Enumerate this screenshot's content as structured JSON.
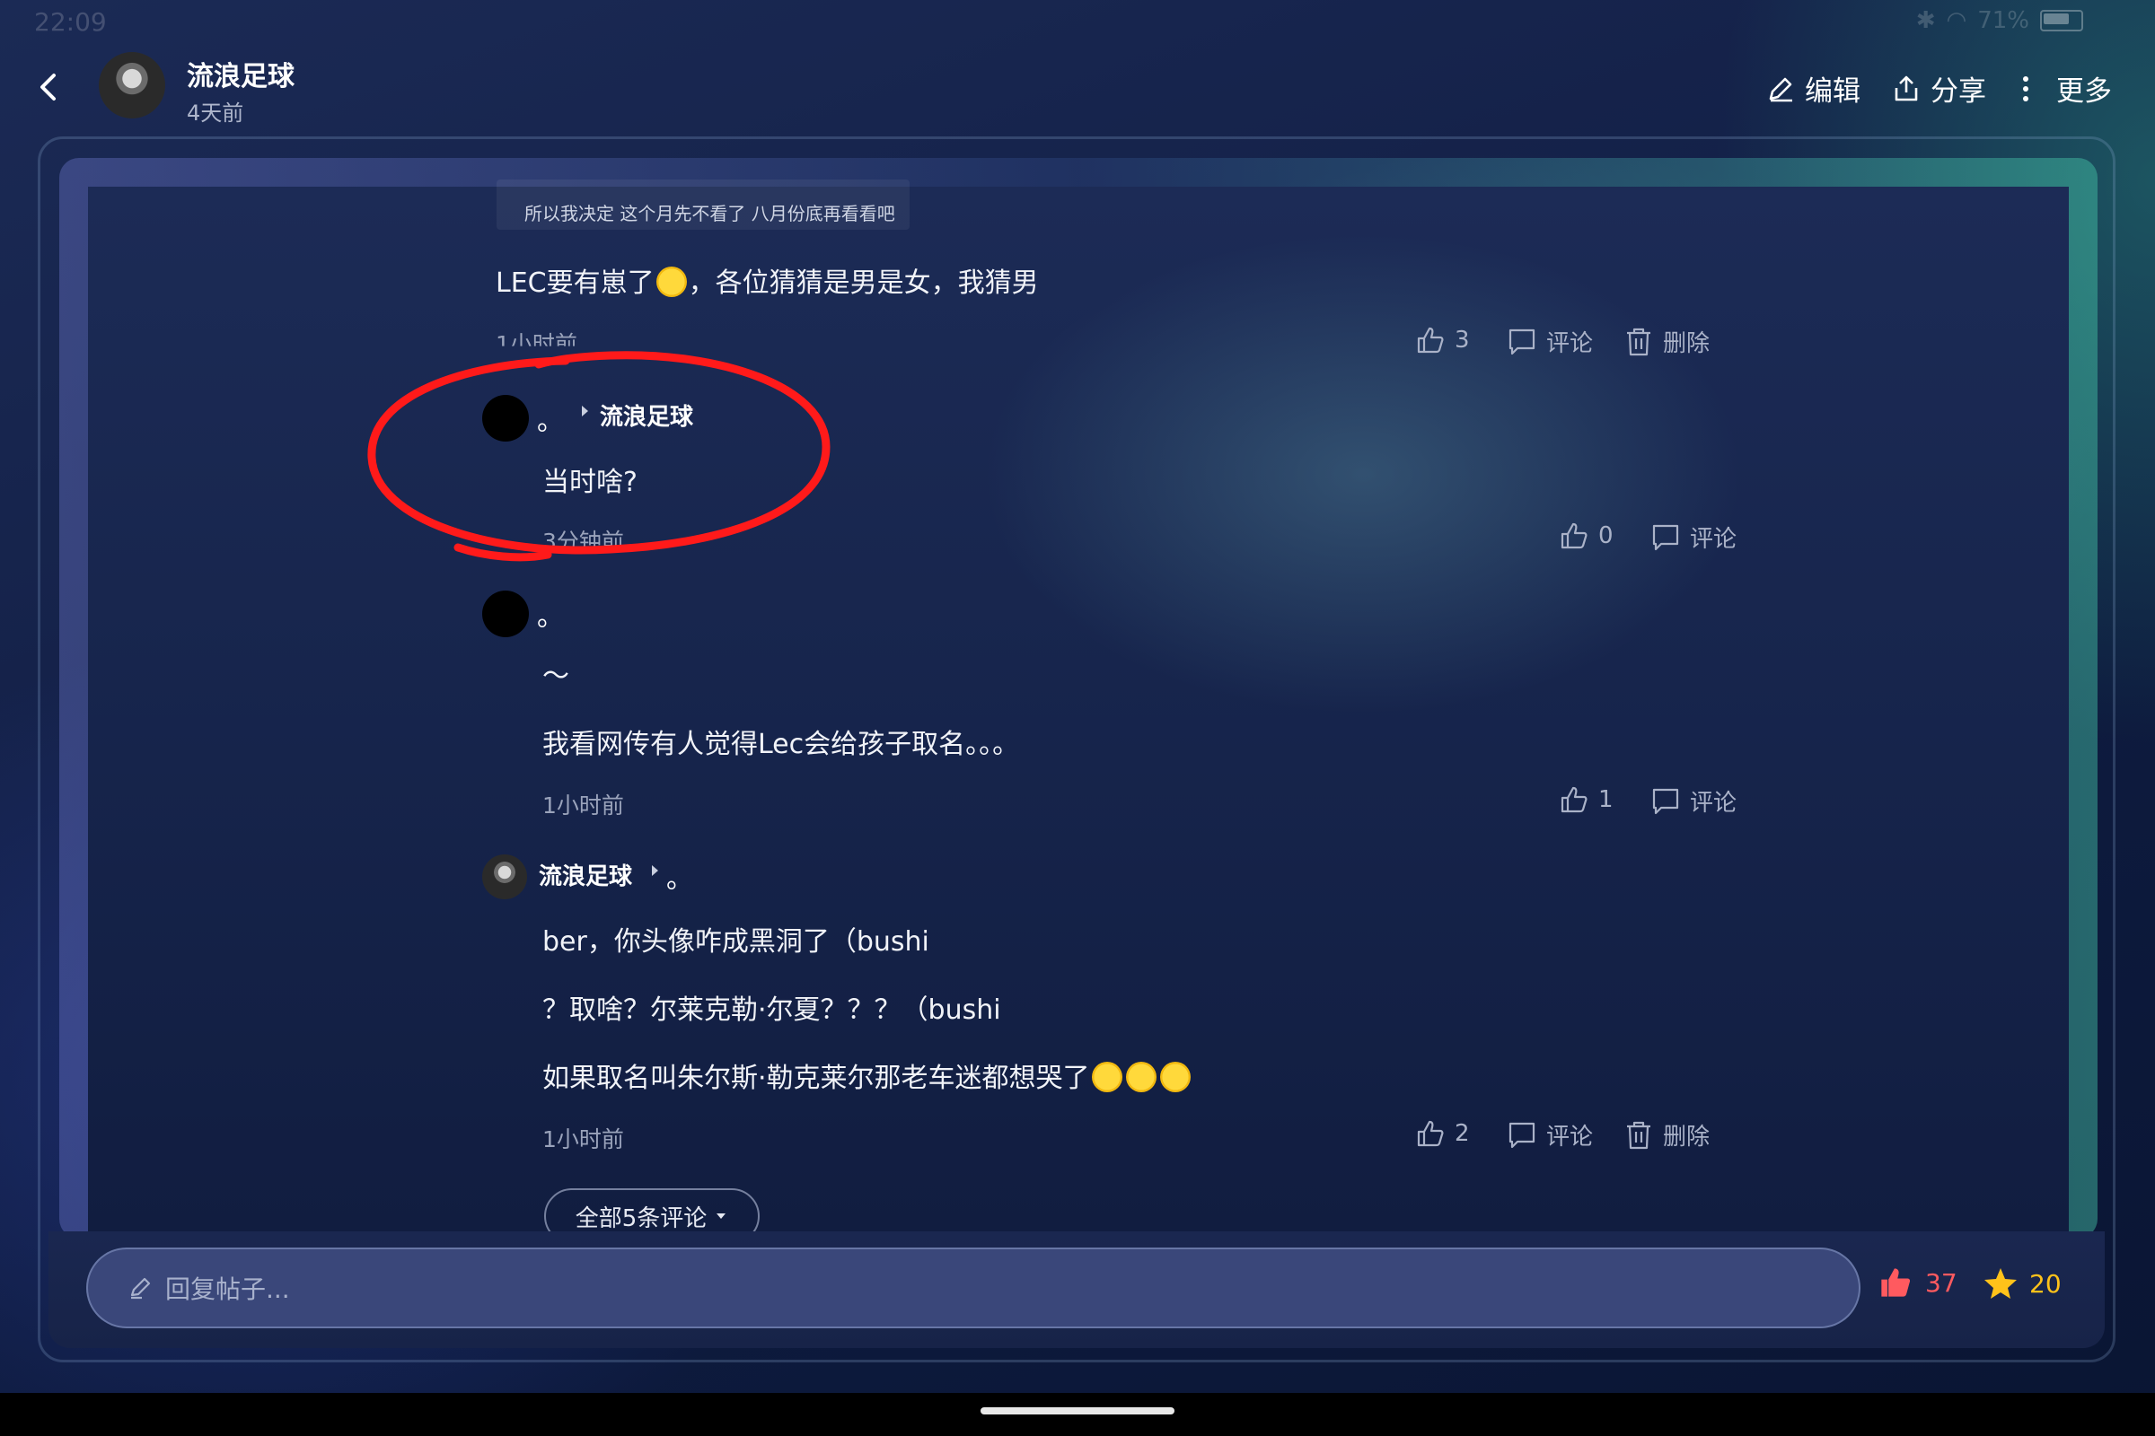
{
  "status_bar": {
    "time": "22:09",
    "battery": "71%"
  },
  "header": {
    "author": "流浪足球",
    "post_time": "4天前",
    "actions": {
      "edit": "编辑",
      "share": "分享",
      "more": "更多"
    }
  },
  "thread": {
    "quote_text": "所以我决定 这个月先不看了 八月份底再看看吧",
    "main_comment": {
      "text_before": "LEC要有崽了",
      "text_after": "，各位猜猜是男是女，我猜男",
      "time": "1小时前",
      "likes": "3",
      "comment_label": "评论",
      "delete_label": "删除"
    },
    "replies": [
      {
        "author": "。",
        "reply_to": "流浪足球",
        "text": "当时啥?",
        "time": "3分钟前",
        "likes": "0",
        "comment_label": "评论"
      },
      {
        "author": "。",
        "line1": "～",
        "line2": "我看网传有人觉得Lec会给孩子取名。。。",
        "time": "1小时前",
        "likes": "1",
        "comment_label": "评论"
      },
      {
        "author": "流浪足球",
        "reply_to": "。",
        "line1": "ber，你头像咋成黑洞了（bushi",
        "line2": "？取啥？尔莱克勒·尔夏？？？（bushi",
        "line3": "如果取名叫朱尔斯·勒克莱尔那老车迷都想哭了",
        "time": "1小时前",
        "likes": "2",
        "comment_label": "评论",
        "delete_label": "删除"
      }
    ],
    "all_comments_label": "全部5条评论"
  },
  "bottom_bar": {
    "reply_placeholder": "回复帖子...",
    "like_count": "37",
    "star_count": "20"
  },
  "colors": {
    "annotation": "#ff1a1a",
    "like": "#ff5a5f",
    "star": "#ffc21a"
  }
}
